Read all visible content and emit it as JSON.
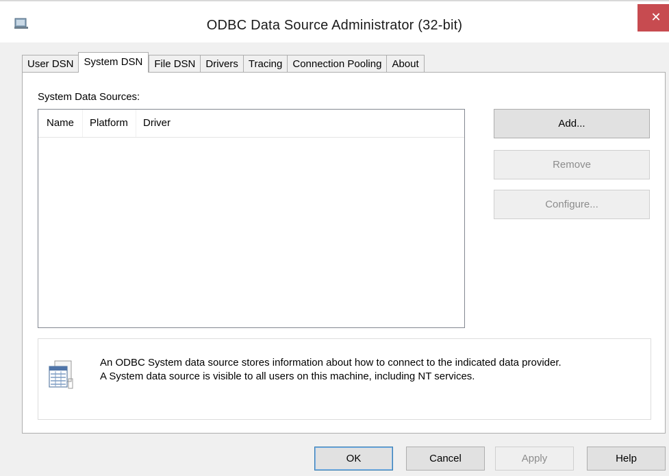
{
  "window": {
    "title": "ODBC Data Source Administrator (32-bit)",
    "close_glyph": "✕"
  },
  "tabs": [
    {
      "label": "User DSN",
      "active": false
    },
    {
      "label": "System DSN",
      "active": true
    },
    {
      "label": "File DSN",
      "active": false
    },
    {
      "label": "Drivers",
      "active": false
    },
    {
      "label": "Tracing",
      "active": false
    },
    {
      "label": "Connection Pooling",
      "active": false
    },
    {
      "label": "About",
      "active": false
    }
  ],
  "panel": {
    "label": "System Data Sources:",
    "columns": [
      "Name",
      "Platform",
      "Driver"
    ],
    "rows": [],
    "buttons": {
      "add": "Add...",
      "remove": "Remove",
      "configure": "Configure..."
    },
    "info": {
      "line1": "An ODBC System data source stores information about how to connect to the indicated data provider.",
      "line2": "A System data source is visible to all users on this machine, including NT services."
    }
  },
  "footer": {
    "ok": "OK",
    "cancel": "Cancel",
    "apply": "Apply",
    "help": "Help"
  },
  "icons": {
    "app": "odbc-admin-icon",
    "info": "data-source-icon",
    "close": "close-icon"
  },
  "colors": {
    "close_bg": "#c74b50",
    "ok_border": "#3c7fb1",
    "disabled_text": "#8c8c8c"
  }
}
